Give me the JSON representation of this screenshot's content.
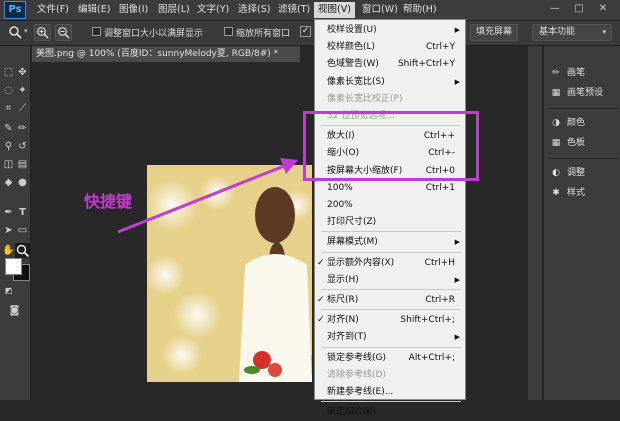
{
  "app": {
    "logo": "Ps"
  },
  "menubar": {
    "items": [
      "文件(F)",
      "编辑(E)",
      "图像(I)",
      "图层(L)",
      "文字(Y)",
      "选择(S)",
      "滤镜(T)",
      "视图(V)",
      "窗口(W)",
      "帮助(H)"
    ],
    "active_index": 7,
    "window_controls": [
      "—",
      "□",
      "✕"
    ]
  },
  "options_bar": {
    "resize_windows_label": "调整窗口大小以满屏显示",
    "zoom_all_label": "缩放所有窗口",
    "fill_screen_label": "填充屏幕",
    "workspace_label": "基本功能"
  },
  "document_tab": {
    "title": "美图.png @ 100% (百度ID：sunnyMelody夏, RGB/8#) *"
  },
  "right_panels": {
    "group1": [
      {
        "icon": "brush-icon",
        "label": "画笔"
      },
      {
        "icon": "brush-preset-icon",
        "label": "画笔预设"
      }
    ],
    "group2": [
      {
        "icon": "color-icon",
        "label": "颜色"
      },
      {
        "icon": "swatches-icon",
        "label": "色板"
      }
    ],
    "group3": [
      {
        "icon": "adjustments-icon",
        "label": "调整"
      },
      {
        "icon": "styles-icon",
        "label": "样式"
      }
    ]
  },
  "view_menu": {
    "items": [
      {
        "label": "校样设置(U)",
        "shortcut": "",
        "submenu": true,
        "disabled": false,
        "checked": false
      },
      {
        "label": "校样颜色(L)",
        "shortcut": "Ctrl+Y",
        "submenu": false,
        "disabled": false,
        "checked": false
      },
      {
        "label": "色域警告(W)",
        "shortcut": "Shift+Ctrl+Y",
        "submenu": false,
        "disabled": false,
        "checked": false
      },
      {
        "label": "像素长宽比(S)",
        "shortcut": "",
        "submenu": true,
        "disabled": false,
        "checked": false
      },
      {
        "label": "像素长宽比校正(P)",
        "shortcut": "",
        "submenu": false,
        "disabled": true,
        "checked": false
      },
      {
        "label": "32 位预览选项...",
        "shortcut": "",
        "submenu": false,
        "disabled": true,
        "checked": false
      },
      {
        "label": "放大(I)",
        "shortcut": "Ctrl++",
        "submenu": false,
        "disabled": false,
        "checked": false
      },
      {
        "label": "缩小(O)",
        "shortcut": "Ctrl+-",
        "submenu": false,
        "disabled": false,
        "checked": false
      },
      {
        "label": "按屏幕大小缩放(F)",
        "shortcut": "Ctrl+0",
        "submenu": false,
        "disabled": false,
        "checked": false
      },
      {
        "label": "100%",
        "shortcut": "Ctrl+1",
        "submenu": false,
        "disabled": false,
        "checked": false
      },
      {
        "label": "200%",
        "shortcut": "",
        "submenu": false,
        "disabled": false,
        "checked": false
      },
      {
        "label": "打印尺寸(Z)",
        "shortcut": "",
        "submenu": false,
        "disabled": false,
        "checked": false
      },
      {
        "label": "屏幕模式(M)",
        "shortcut": "",
        "submenu": true,
        "disabled": false,
        "checked": false
      },
      {
        "label": "显示额外内容(X)",
        "shortcut": "Ctrl+H",
        "submenu": false,
        "disabled": false,
        "checked": true
      },
      {
        "label": "显示(H)",
        "shortcut": "",
        "submenu": true,
        "disabled": false,
        "checked": false
      },
      {
        "label": "标尺(R)",
        "shortcut": "Ctrl+R",
        "submenu": false,
        "disabled": false,
        "checked": true
      },
      {
        "label": "对齐(N)",
        "shortcut": "Shift+Ctrl+;",
        "submenu": false,
        "disabled": false,
        "checked": true
      },
      {
        "label": "对齐到(T)",
        "shortcut": "",
        "submenu": true,
        "disabled": false,
        "checked": false
      },
      {
        "label": "锁定参考线(G)",
        "shortcut": "Alt+Ctrl+;",
        "submenu": false,
        "disabled": false,
        "checked": false
      },
      {
        "label": "清除参考线(D)",
        "shortcut": "",
        "submenu": false,
        "disabled": true,
        "checked": false
      },
      {
        "label": "新建参考线(E)...",
        "shortcut": "",
        "submenu": false,
        "disabled": false,
        "checked": false
      },
      {
        "label": "锁定切片(K)",
        "shortcut": "",
        "submenu": false,
        "disabled": false,
        "checked": false
      }
    ],
    "separators_after": [
      5,
      11,
      12,
      14,
      15,
      17,
      20
    ]
  },
  "annotation": {
    "label": "快捷键",
    "color": "#c23bd0"
  }
}
